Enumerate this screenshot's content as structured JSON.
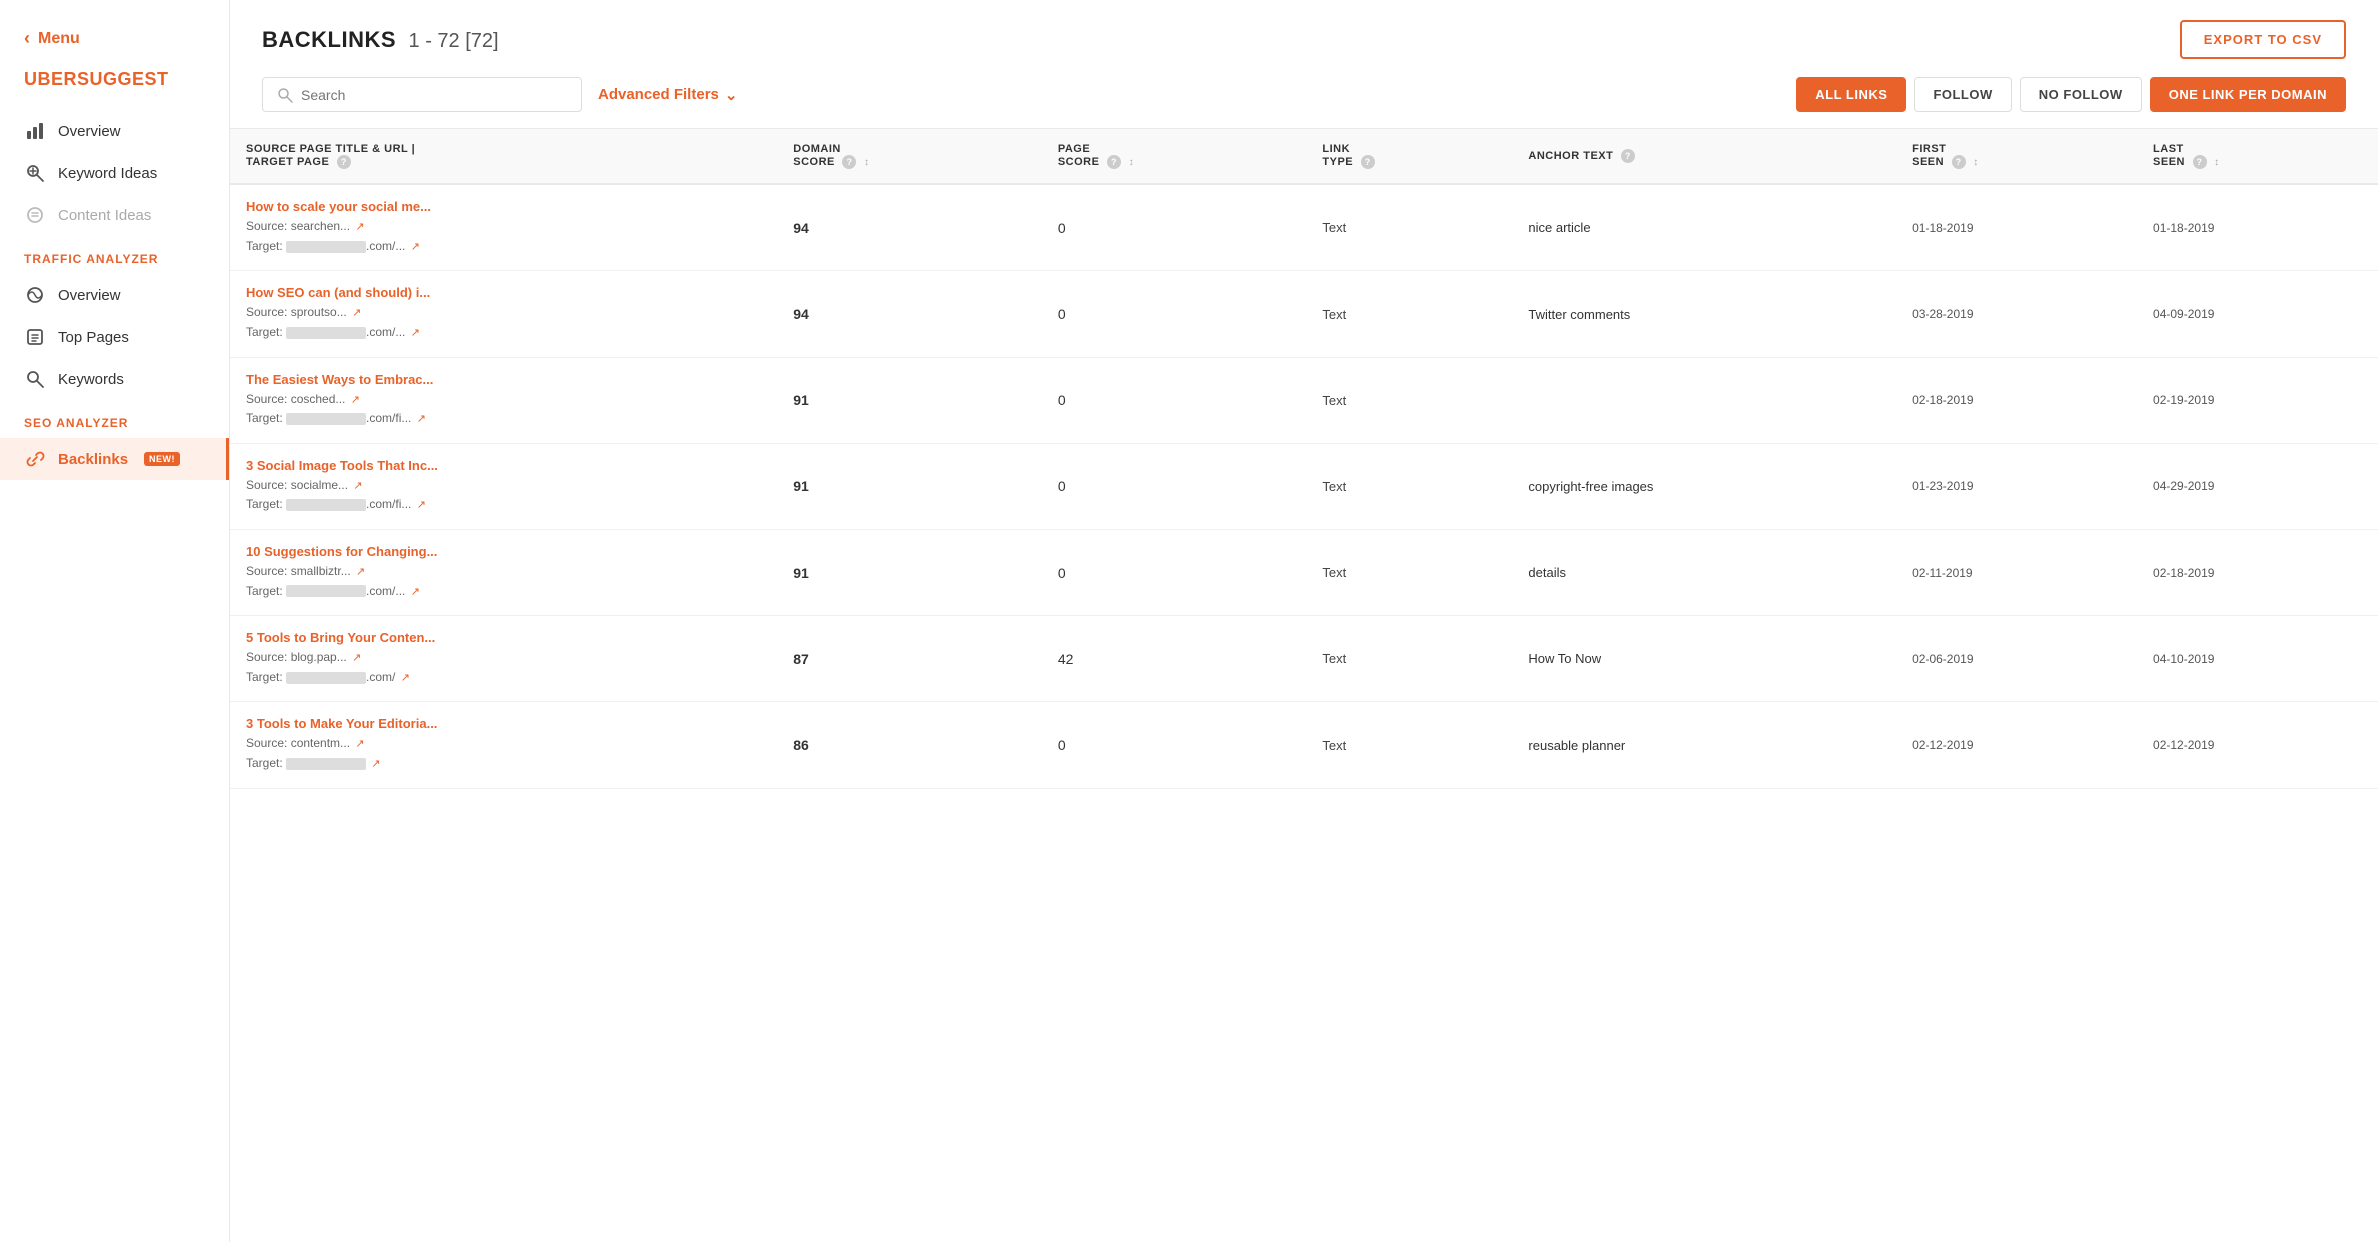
{
  "sidebar": {
    "menu_label": "Menu",
    "brand": "UBERSUGGEST",
    "sections": [
      {
        "label": null,
        "items": [
          {
            "id": "overview-seo",
            "label": "Overview",
            "icon": "chart-icon",
            "active": false,
            "dimmed": false
          }
        ]
      },
      {
        "label": null,
        "items": [
          {
            "id": "keyword-ideas",
            "label": "Keyword Ideas",
            "icon": "keyword-icon",
            "active": false,
            "dimmed": false
          },
          {
            "id": "content-ideas",
            "label": "Content Ideas",
            "icon": "content-icon",
            "active": false,
            "dimmed": true
          }
        ]
      },
      {
        "label": "TRAFFIC ANALYZER",
        "items": [
          {
            "id": "traffic-overview",
            "label": "Overview",
            "icon": "traffic-icon",
            "active": false,
            "dimmed": false
          },
          {
            "id": "top-pages",
            "label": "Top Pages",
            "icon": "pages-icon",
            "active": false,
            "dimmed": false
          },
          {
            "id": "keywords",
            "label": "Keywords",
            "icon": "keywords-icon",
            "active": false,
            "dimmed": false
          }
        ]
      },
      {
        "label": "SEO ANALYZER",
        "items": [
          {
            "id": "backlinks",
            "label": "Backlinks",
            "icon": "backlinks-icon",
            "active": true,
            "badge": "NEW!",
            "dimmed": false
          }
        ]
      }
    ]
  },
  "header": {
    "title": "BACKLINKS",
    "count": "1 - 72 [72]",
    "export_btn": "EXPORT TO CSV"
  },
  "filters": {
    "search_placeholder": "Search",
    "advanced_filters_label": "Advanced Filters",
    "buttons": [
      {
        "id": "all-links",
        "label": "ALL LINKS",
        "active": true
      },
      {
        "id": "follow",
        "label": "FOLLOW",
        "active": false
      },
      {
        "id": "no-follow",
        "label": "NO FOLLOW",
        "active": false
      },
      {
        "id": "one-link",
        "label": "ONE LINK PER DOMAIN",
        "active": false,
        "orange": true
      }
    ]
  },
  "table": {
    "columns": [
      {
        "id": "source",
        "label": "SOURCE PAGE TITLE & URL | TARGET PAGE"
      },
      {
        "id": "domain_score",
        "label": "DOMAIN SCORE"
      },
      {
        "id": "page_score",
        "label": "PAGE SCORE"
      },
      {
        "id": "link_type",
        "label": "LINK TYPE"
      },
      {
        "id": "anchor_text",
        "label": "ANCHOR TEXT"
      },
      {
        "id": "first_seen",
        "label": "FIRST SEEN"
      },
      {
        "id": "last_seen",
        "label": "LAST SEEN"
      }
    ],
    "rows": [
      {
        "title": "How to scale your social me...",
        "source": "searchen...",
        "target": ".com/...",
        "domain_score": 94,
        "page_score": 0,
        "link_type": "Text",
        "anchor_text": "nice article",
        "first_seen": "01-18-2019",
        "last_seen": "01-18-2019"
      },
      {
        "title": "How SEO can (and should) i...",
        "source": "sproutso...",
        "target": ".com/...",
        "domain_score": 94,
        "page_score": 0,
        "link_type": "Text",
        "anchor_text": "Twitter comments",
        "first_seen": "03-28-2019",
        "last_seen": "04-09-2019"
      },
      {
        "title": "The Easiest Ways to Embrac...",
        "source": "cosched...",
        "target": ".com/fi...",
        "domain_score": 91,
        "page_score": 0,
        "link_type": "Text",
        "anchor_text": "",
        "first_seen": "02-18-2019",
        "last_seen": "02-19-2019"
      },
      {
        "title": "3 Social Image Tools That Inc...",
        "source": "socialme...",
        "target": ".com/fi...",
        "domain_score": 91,
        "page_score": 0,
        "link_type": "Text",
        "anchor_text": "copyright-free images",
        "first_seen": "01-23-2019",
        "last_seen": "04-29-2019"
      },
      {
        "title": "10 Suggestions for Changing...",
        "source": "smallbiztr...",
        "target": ".com/...",
        "domain_score": 91,
        "page_score": 0,
        "link_type": "Text",
        "anchor_text": "details",
        "first_seen": "02-11-2019",
        "last_seen": "02-18-2019"
      },
      {
        "title": "5 Tools to Bring Your Conten...",
        "source": "blog.pap...",
        "target": ".com/",
        "domain_score": 87,
        "page_score": 42,
        "link_type": "Text",
        "anchor_text": "How To Now",
        "first_seen": "02-06-2019",
        "last_seen": "04-10-2019"
      },
      {
        "title": "3 Tools to Make Your Editoria...",
        "source": "contentm...",
        "target": "",
        "domain_score": 86,
        "page_score": 0,
        "link_type": "Text",
        "anchor_text": "reusable planner",
        "first_seen": "02-12-2019",
        "last_seen": "02-12-2019"
      }
    ]
  },
  "colors": {
    "orange": "#e8622a",
    "orange_light": "#fef0e8"
  }
}
